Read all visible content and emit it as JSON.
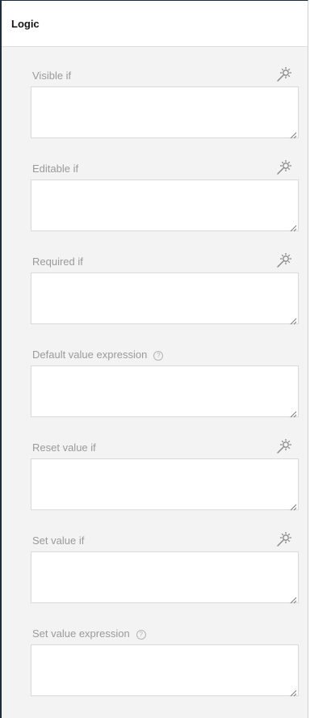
{
  "panel": {
    "title": "Logic"
  },
  "fields": [
    {
      "label": "Visible if",
      "has_wand": true,
      "has_help": false,
      "value": ""
    },
    {
      "label": "Editable if",
      "has_wand": true,
      "has_help": false,
      "value": ""
    },
    {
      "label": "Required if",
      "has_wand": true,
      "has_help": false,
      "value": ""
    },
    {
      "label": "Default value expression",
      "has_wand": false,
      "has_help": true,
      "value": ""
    },
    {
      "label": "Reset value if",
      "has_wand": true,
      "has_help": false,
      "value": ""
    },
    {
      "label": "Set value if",
      "has_wand": true,
      "has_help": false,
      "value": ""
    },
    {
      "label": "Set value expression",
      "has_wand": false,
      "has_help": true,
      "value": ""
    }
  ],
  "icons": {
    "wand": "magic-wand-icon",
    "help": "question-circle-icon",
    "help_glyph": "?"
  },
  "colors": {
    "panel_border": "#1f2d3a",
    "label": "#9a9a9a",
    "body_bg": "#f3f3f3"
  }
}
